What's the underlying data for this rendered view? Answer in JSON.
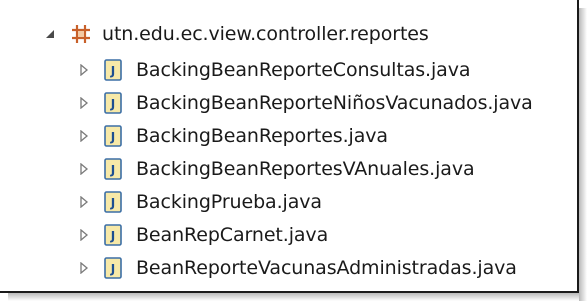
{
  "tree": {
    "package": {
      "label": "utn.edu.ec.view.controller.reportes",
      "icon": "package-icon",
      "expanded": true
    },
    "files": [
      {
        "label": "BackingBeanReporteConsultas.java",
        "icon": "java-file-icon"
      },
      {
        "label": "BackingBeanReporteNiñosVacunados.java",
        "icon": "java-file-icon"
      },
      {
        "label": "BackingBeanReportes.java",
        "icon": "java-file-icon"
      },
      {
        "label": "BackingBeanReportesVAnuales.java",
        "icon": "java-file-icon"
      },
      {
        "label": "BackingPrueba.java",
        "icon": "java-file-icon"
      },
      {
        "label": "BeanRepCarnet.java",
        "icon": "java-file-icon"
      },
      {
        "label": "BeanReporteVacunasAdministradas.java",
        "icon": "java-file-icon"
      }
    ]
  },
  "colors": {
    "package_icon": "#c8602a",
    "java_icon_border": "#3b6ea5",
    "java_icon_fill": "#f7e9a8",
    "java_icon_letter": "#1d4f91",
    "twisty": "#7a7a7a"
  }
}
